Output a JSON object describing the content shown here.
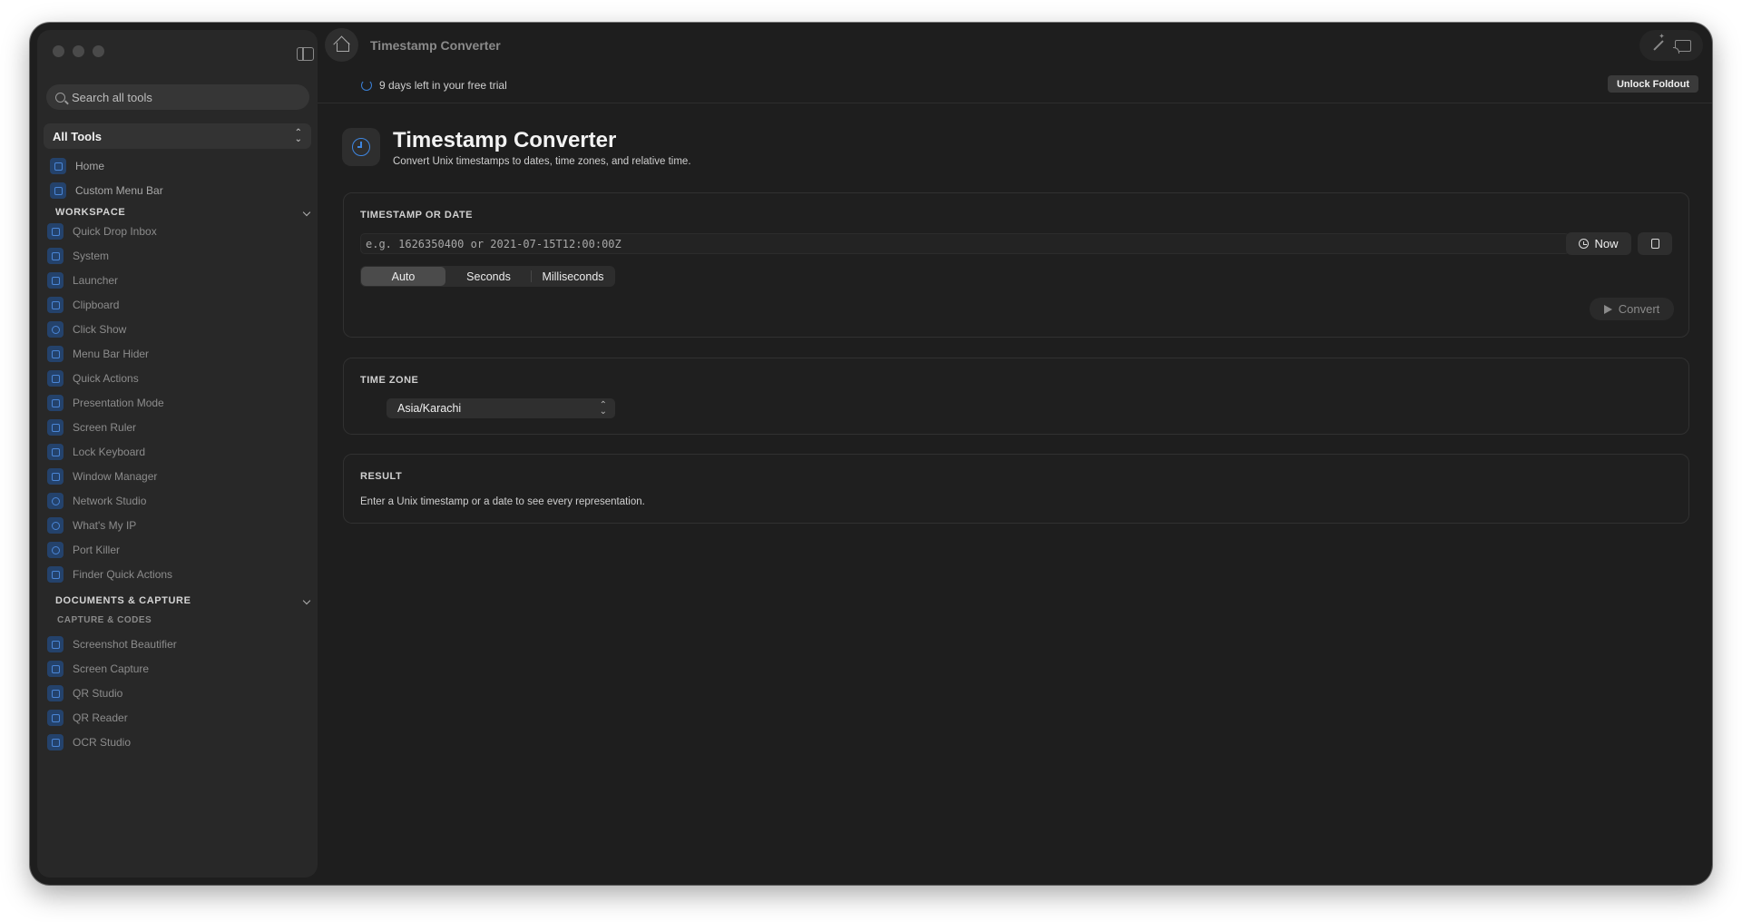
{
  "window": {
    "title": "Timestamp Converter"
  },
  "sidebar": {
    "search_placeholder": "Search all tools",
    "tools_filter": "All Tools",
    "top_items": [
      {
        "label": "Home",
        "icon": "home-icon"
      },
      {
        "label": "Custom Menu Bar",
        "icon": "menubar-icon"
      }
    ],
    "sections": [
      {
        "title": "WORKSPACE",
        "items": [
          {
            "label": "Quick Drop Inbox",
            "icon": "inbox-icon"
          },
          {
            "label": "System",
            "icon": "system-icon"
          },
          {
            "label": "Launcher",
            "icon": "command-icon"
          },
          {
            "label": "Clipboard",
            "icon": "clipboard-icon"
          },
          {
            "label": "Click Show",
            "icon": "click-icon"
          },
          {
            "label": "Menu Bar Hider",
            "icon": "menubar-hider-icon"
          },
          {
            "label": "Quick Actions",
            "icon": "quick-actions-icon"
          },
          {
            "label": "Presentation Mode",
            "icon": "presentation-icon"
          },
          {
            "label": "Screen Ruler",
            "icon": "ruler-icon"
          },
          {
            "label": "Lock Keyboard",
            "icon": "lock-icon"
          },
          {
            "label": "Window Manager",
            "icon": "window-icon"
          },
          {
            "label": "Network Studio",
            "icon": "network-icon"
          },
          {
            "label": "What's My IP",
            "icon": "globe-icon"
          },
          {
            "label": "Port Killer",
            "icon": "port-icon"
          },
          {
            "label": "Finder Quick Actions",
            "icon": "finder-icon"
          }
        ]
      },
      {
        "title": "DOCUMENTS & CAPTURE",
        "subsection": "CAPTURE & CODES",
        "items": [
          {
            "label": "Screenshot Beautifier",
            "icon": "screenshot-icon"
          },
          {
            "label": "Screen Capture",
            "icon": "capture-icon"
          },
          {
            "label": "QR Studio",
            "icon": "qr-icon"
          },
          {
            "label": "QR Reader",
            "icon": "qr-reader-icon"
          },
          {
            "label": "OCR Studio",
            "icon": "ocr-icon"
          }
        ]
      }
    ]
  },
  "trial_banner": {
    "text": "9 days left in your free trial",
    "unlock_label": "Unlock Foldout"
  },
  "page": {
    "title": "Timestamp Converter",
    "subtitle": "Convert Unix timestamps to dates, time zones, and relative time."
  },
  "timestamp_card": {
    "label": "TIMESTAMP OR DATE",
    "input_value": "",
    "input_placeholder": "e.g. 1626350400 or 2021-07-15T12:00:00Z",
    "now_label": "Now",
    "units": [
      "Auto",
      "Seconds",
      "Milliseconds"
    ],
    "selected_unit": "Auto",
    "convert_label": "Convert"
  },
  "timezone_card": {
    "label": "TIME ZONE",
    "selected": "Asia/Karachi"
  },
  "result_card": {
    "label": "RESULT",
    "message": "Enter a Unix timestamp or a date to see every representation."
  },
  "colors": {
    "accent": "#3e86e0",
    "window_bg": "#1e1e1e",
    "sidebar_bg": "#282828"
  }
}
